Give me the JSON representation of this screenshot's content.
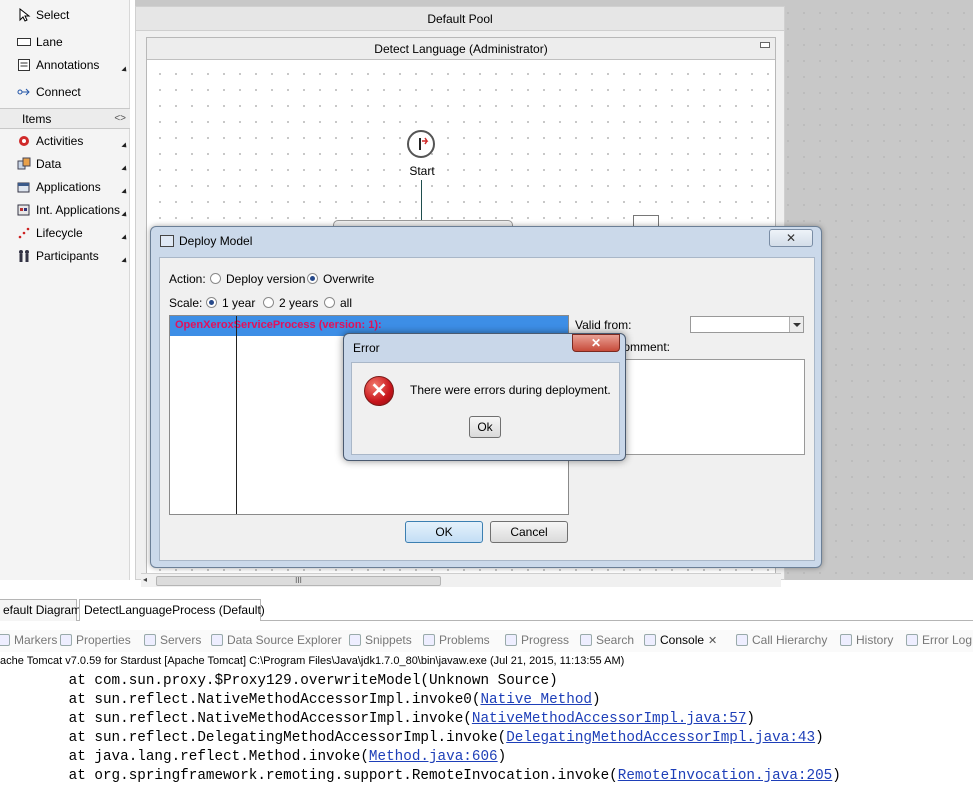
{
  "palette": {
    "select": "Select",
    "lane": "Lane",
    "annotations": "Annotations",
    "connect": "Connect",
    "items_drawer": "Items",
    "activities": "Activities",
    "data": "Data",
    "applications": "Applications",
    "int_applications": "Int. Applications",
    "lifecycle": "Lifecycle",
    "participants": "Participants"
  },
  "diagram": {
    "pool_title": "Default Pool",
    "lane_title": "Detect Language (Administrator)",
    "start_label": "Start",
    "scroll_thumb": "III"
  },
  "deploy": {
    "title": "Deploy Model",
    "close": "✕",
    "action_label": "Action:",
    "deploy_version": "Deploy version",
    "overwrite": "Overwrite",
    "scale_label": "Scale:",
    "one_year": "1 year",
    "two_years": "2 years",
    "all": "all",
    "process_row": "OpenXeroxServiceProcess (version: 1):",
    "valid_from": "Valid from:",
    "comment_label": "t Comment:",
    "ok": "OK",
    "cancel": "Cancel"
  },
  "error_dialog": {
    "title": "Error",
    "close": "✕",
    "icon": "✕",
    "message": "There were errors during deployment.",
    "ok": "Ok"
  },
  "editor_tabs": [
    "efault Diagram",
    "DetectLanguageProcess (Default)"
  ],
  "views": {
    "markers": "Markers",
    "properties": "Properties",
    "servers": "Servers",
    "datasource": "Data Source Explorer",
    "snippets": "Snippets",
    "problems": "Problems",
    "progress": "Progress",
    "search": "Search",
    "console": "Console",
    "console_close": "✕",
    "call_hierarchy": "Call Hierarchy",
    "history": "History",
    "error_log": "Error Log"
  },
  "console": {
    "header": "ache Tomcat v7.0.59 for Stardust [Apache Tomcat] C:\\Program Files\\Java\\jdk1.7.0_80\\bin\\javaw.exe (Jul 21, 2015, 11:13:55 AM)",
    "lines": [
      {
        "pre": "        at com.sun.proxy.$Proxy129.overwriteModel(Unknown Source)",
        "link": "",
        "post": ""
      },
      {
        "pre": "        at sun.reflect.NativeMethodAccessorImpl.invoke0(",
        "link": "Native Method",
        "post": ")"
      },
      {
        "pre": "        at sun.reflect.NativeMethodAccessorImpl.invoke(",
        "link": "NativeMethodAccessorImpl.java:57",
        "post": ")"
      },
      {
        "pre": "        at sun.reflect.DelegatingMethodAccessorImpl.invoke(",
        "link": "DelegatingMethodAccessorImpl.java:43",
        "post": ")"
      },
      {
        "pre": "        at java.lang.reflect.Method.invoke(",
        "link": "Method.java:606",
        "post": ")"
      },
      {
        "pre": "        at org.springframework.remoting.support.RemoteInvocation.invoke(",
        "link": "RemoteInvocation.java:205",
        "post": ")"
      }
    ]
  }
}
